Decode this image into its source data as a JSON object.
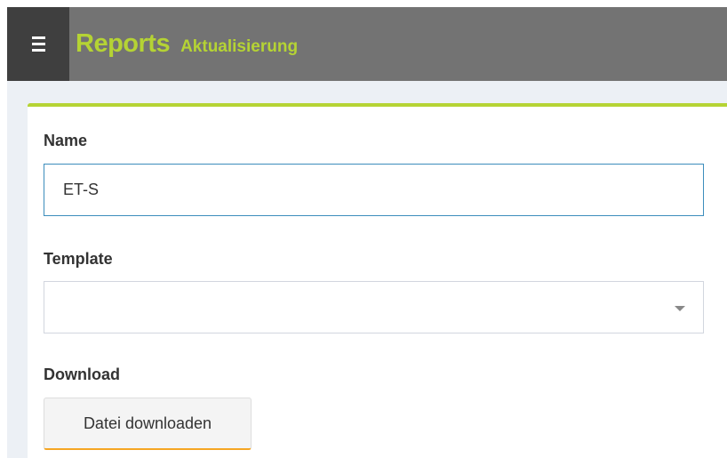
{
  "header": {
    "menu_icon": "hamburger-menu-icon",
    "title": "Reports",
    "subtitle": "Aktualisierung",
    "accent_color": "#b5d334"
  },
  "form": {
    "name_label": "Name",
    "name_value": "ET-S",
    "template_label": "Template",
    "template_value": "",
    "download_label": "Download",
    "download_button": "Datei downloaden"
  },
  "colors": {
    "header_bg": "#737373",
    "menu_bg": "#3f3f3f",
    "focus_border": "#3c8dbc",
    "button_underline": "#f5a623"
  }
}
